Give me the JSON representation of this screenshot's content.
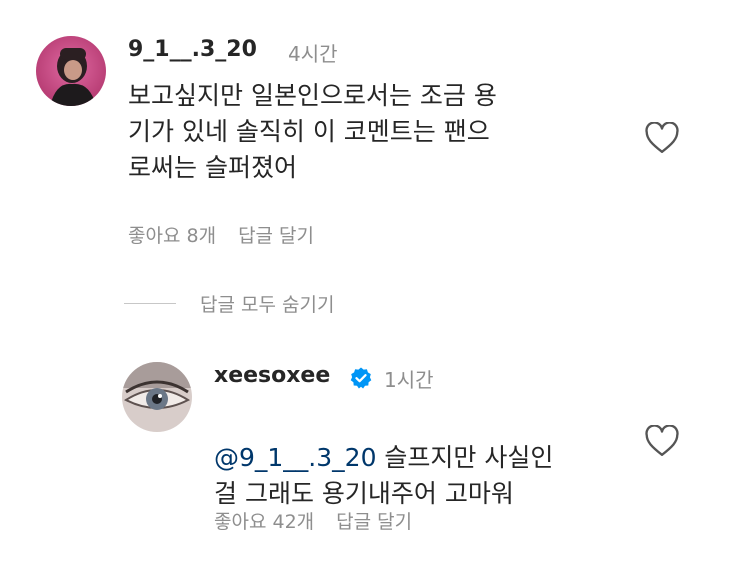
{
  "comment": {
    "username": "9_1__.3_20",
    "timestamp": "4시간",
    "text": "보고싶지만 일본인으로서는 조금 용\n기가 있네 솔직히 이 코멘트는 팬으\n로써는 슬퍼졌어",
    "likes": "좋아요 8개",
    "reply_label": "답글 달기",
    "avatar_icon": "user-avatar-photo",
    "heart_icon": "heart-outline-icon"
  },
  "replies_toggle": {
    "label": "답글 모두 숨기기"
  },
  "reply": {
    "username": "xeesoxee",
    "verified_icon": "verified-badge-icon",
    "timestamp": "1시간",
    "mention": "@9_1__.3_20",
    "text_line1": " 슬프지만 사실인",
    "text_line2": "걸 그래도 용기내주어 고마워",
    "likes": "좋아요 42개",
    "reply_label": "답글 달기",
    "avatar_icon": "user-avatar-photo",
    "heart_icon": "heart-outline-icon"
  },
  "colors": {
    "text": "#262626",
    "muted": "#8e8e8e",
    "mention": "#00376b",
    "verified": "#0095f6"
  }
}
